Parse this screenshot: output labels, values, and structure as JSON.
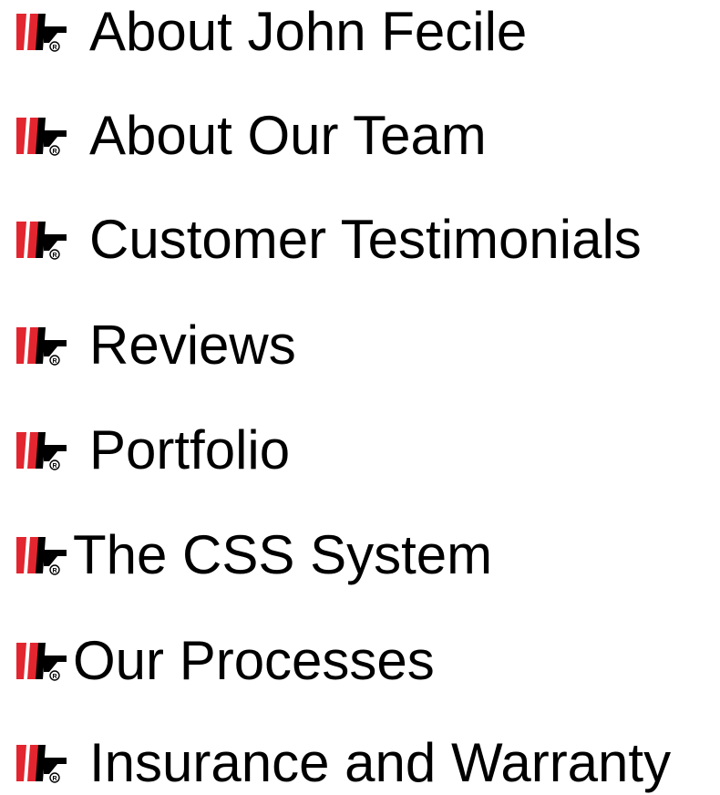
{
  "brand": {
    "red": "#e2252f",
    "black": "#000000",
    "icon": "company-logo-icon"
  },
  "menu": {
    "items": [
      {
        "label": "About John Fecile"
      },
      {
        "label": "About Our Team"
      },
      {
        "label": "Customer Testimonials"
      },
      {
        "label": "Reviews"
      },
      {
        "label": "Portfolio"
      },
      {
        "label": "The CSS System"
      },
      {
        "label": "Our Processes"
      },
      {
        "label": "Insurance and Warranty"
      }
    ]
  }
}
